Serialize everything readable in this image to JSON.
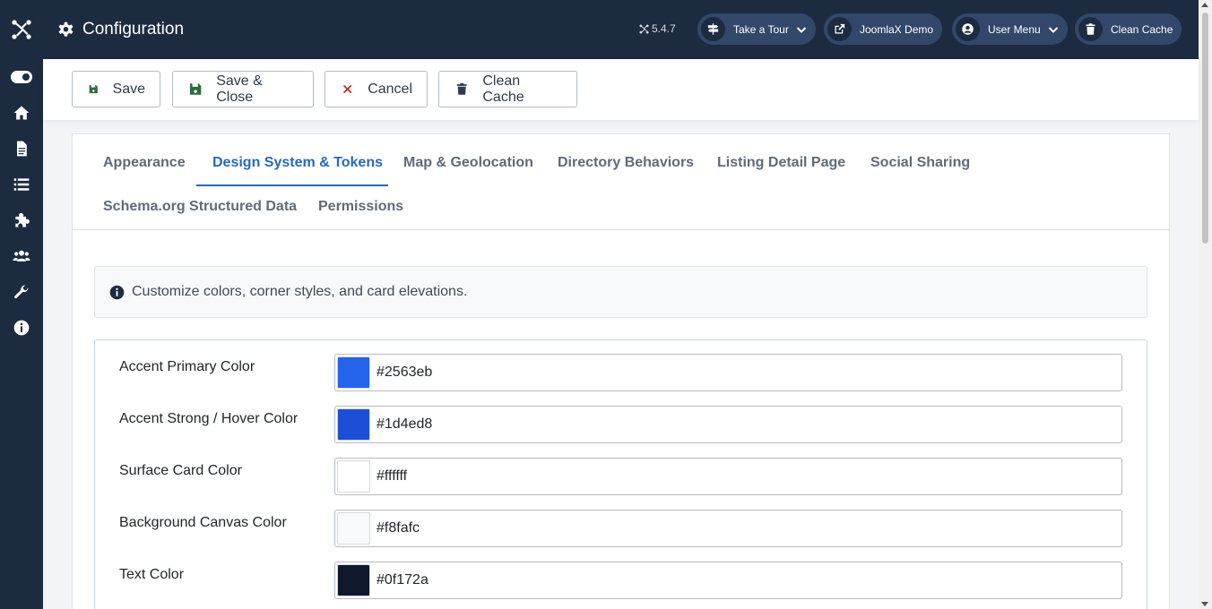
{
  "header": {
    "title": "Configuration",
    "version": "5.4.7",
    "buttons": [
      {
        "label": "Take a Tour",
        "icon": "signpost-icon",
        "has_dropdown": true
      },
      {
        "label": "JoomlaX Demo",
        "icon": "external-link-icon",
        "has_dropdown": false
      },
      {
        "label": "User Menu",
        "icon": "user-circle-icon",
        "has_dropdown": true
      },
      {
        "label": "Clean Cache",
        "icon": "trash-icon",
        "has_dropdown": false
      }
    ]
  },
  "sidebar": {
    "items": [
      {
        "icon": "joomla-logo-icon"
      },
      {
        "icon": "toggle-menu-icon"
      },
      {
        "icon": "home-icon"
      },
      {
        "icon": "document-icon"
      },
      {
        "icon": "list-icon"
      },
      {
        "icon": "puzzle-icon"
      },
      {
        "icon": "users-icon"
      },
      {
        "icon": "wrench-icon"
      },
      {
        "icon": "info-icon"
      }
    ]
  },
  "toolbar": {
    "save_label": "Save",
    "save_close_label": "Save & Close",
    "cancel_label": "Cancel",
    "clean_cache_label": "Clean Cache"
  },
  "tabs": [
    {
      "label": "Appearance",
      "active": false
    },
    {
      "label": "Design System & Tokens",
      "active": true
    },
    {
      "label": "Map & Geolocation",
      "active": false
    },
    {
      "label": "Directory Behaviors",
      "active": false
    },
    {
      "label": "Listing Detail Page",
      "active": false
    },
    {
      "label": "Social Sharing",
      "active": false
    },
    {
      "label": "Schema.org Structured Data",
      "active": false
    },
    {
      "label": "Permissions",
      "active": false
    }
  ],
  "info_message": "Customize colors, corner styles, and card elevations.",
  "fields": [
    {
      "label": "Accent Primary Color",
      "value": "#2563eb"
    },
    {
      "label": "Accent Strong / Hover Color",
      "value": "#1d4ed8"
    },
    {
      "label": "Surface Card Color",
      "value": "#ffffff"
    },
    {
      "label": "Background Canvas Color",
      "value": "#f8fafc"
    },
    {
      "label": "Text Color",
      "value": "#0f172a"
    }
  ],
  "colors": {
    "header_bg": "#1d2b41",
    "header_button_bg": "#32476a",
    "active_tab": "#2a69b8"
  }
}
